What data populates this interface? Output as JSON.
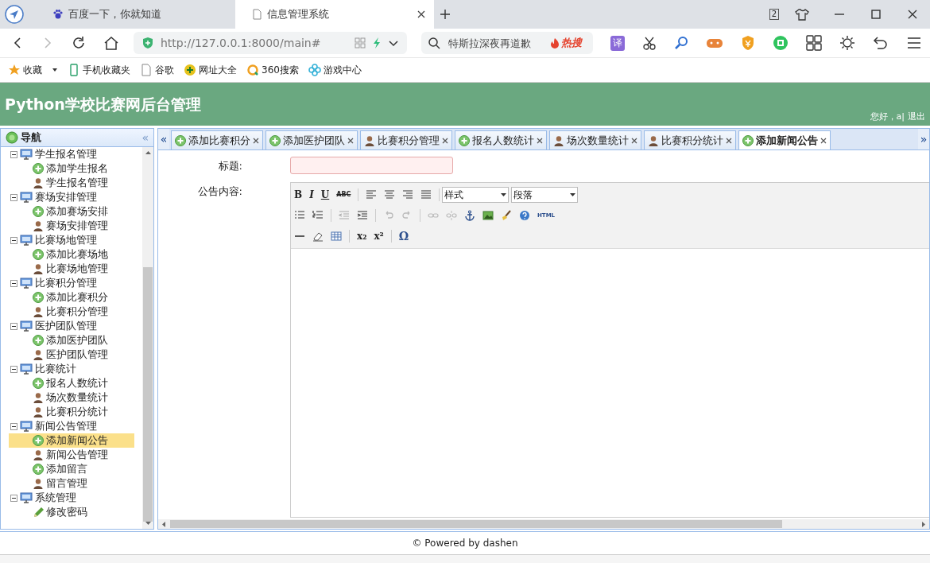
{
  "browser": {
    "tabs": [
      {
        "title": "百度一下，你就知道",
        "selected": false
      },
      {
        "title": "信息管理系统",
        "selected": true
      }
    ],
    "window_badge": "2",
    "url": "http://127.0.0.1:8000/main#",
    "search": {
      "placeholder": "特斯拉深夜再道歉",
      "hot": "热搜"
    },
    "translate": "译",
    "bookmarks": [
      "收藏",
      "手机收藏夹",
      "谷歌",
      "网址大全",
      "360搜索",
      "游戏中心"
    ]
  },
  "header": {
    "title": "Python学校比赛网后台管理",
    "greeting": "您好，a|",
    "logout": "退出"
  },
  "nav": {
    "title": "导航",
    "collapse": "«",
    "groups": [
      {
        "label": "学生报名管理",
        "expanded": true,
        "children": [
          {
            "label": "添加学生报名",
            "kind": "add",
            "selected": false
          },
          {
            "label": "学生报名管理",
            "kind": "user",
            "selected": false
          }
        ]
      },
      {
        "label": "赛场安排管理",
        "expanded": true,
        "children": [
          {
            "label": "添加赛场安排",
            "kind": "add",
            "selected": false
          },
          {
            "label": "赛场安排管理",
            "kind": "user",
            "selected": false
          }
        ]
      },
      {
        "label": "比赛场地管理",
        "expanded": true,
        "children": [
          {
            "label": "添加比赛场地",
            "kind": "add",
            "selected": false
          },
          {
            "label": "比赛场地管理",
            "kind": "user",
            "selected": false
          }
        ]
      },
      {
        "label": "比赛积分管理",
        "expanded": true,
        "children": [
          {
            "label": "添加比赛积分",
            "kind": "add",
            "selected": false
          },
          {
            "label": "比赛积分管理",
            "kind": "user",
            "selected": false
          }
        ]
      },
      {
        "label": "医护团队管理",
        "expanded": true,
        "children": [
          {
            "label": "添加医护团队",
            "kind": "add",
            "selected": false
          },
          {
            "label": "医护团队管理",
            "kind": "user",
            "selected": false
          }
        ]
      },
      {
        "label": "比赛统计",
        "expanded": true,
        "children": [
          {
            "label": "报名人数统计",
            "kind": "add",
            "selected": false
          },
          {
            "label": "场次数量统计",
            "kind": "user",
            "selected": false
          },
          {
            "label": "比赛积分统计",
            "kind": "user",
            "selected": false
          }
        ]
      },
      {
        "label": "新闻公告管理",
        "expanded": true,
        "children": [
          {
            "label": "添加新闻公告",
            "kind": "add",
            "selected": true
          },
          {
            "label": "新闻公告管理",
            "kind": "user",
            "selected": false
          },
          {
            "label": "添加留言",
            "kind": "add",
            "selected": false
          },
          {
            "label": "留言管理",
            "kind": "user",
            "selected": false
          }
        ]
      },
      {
        "label": "系统管理",
        "expanded": true,
        "children": [
          {
            "label": "修改密码",
            "kind": "pencil",
            "selected": false
          }
        ]
      }
    ]
  },
  "content_tabs": {
    "prev": "«",
    "next": "»",
    "tabs": [
      {
        "label": "添加比赛积分",
        "kind": "add",
        "selected": false
      },
      {
        "label": "添加医护团队",
        "kind": "add",
        "selected": false
      },
      {
        "label": "比赛积分管理",
        "kind": "user",
        "selected": false
      },
      {
        "label": "报名人数统计",
        "kind": "add",
        "selected": false
      },
      {
        "label": "场次数量统计",
        "kind": "user",
        "selected": false
      },
      {
        "label": "比赛积分统计",
        "kind": "user",
        "selected": false
      },
      {
        "label": "添加新闻公告",
        "kind": "add",
        "selected": true
      }
    ]
  },
  "form": {
    "title_label": "标题:",
    "content_label": "公告内容:",
    "style_select": "样式",
    "paragraph_select": "段落",
    "toolbar": [
      [
        {
          "kind": "bold",
          "text": "B"
        },
        {
          "kind": "italic",
          "text": "I"
        },
        {
          "kind": "underline",
          "text": "U"
        },
        {
          "kind": "strike",
          "text": "ABC"
        },
        {
          "kind": "sep"
        },
        {
          "kind": "align-left"
        },
        {
          "kind": "align-center"
        },
        {
          "kind": "align-right"
        },
        {
          "kind": "justify"
        },
        {
          "kind": "sep"
        },
        {
          "kind": "style-select"
        },
        {
          "kind": "paragraph-select"
        }
      ],
      [
        {
          "kind": "bullets"
        },
        {
          "kind": "numbers"
        },
        {
          "kind": "sep"
        },
        {
          "kind": "outdent"
        },
        {
          "kind": "indent"
        },
        {
          "kind": "sep"
        },
        {
          "kind": "undo"
        },
        {
          "kind": "redo"
        },
        {
          "kind": "sep"
        },
        {
          "kind": "link"
        },
        {
          "kind": "unlink"
        },
        {
          "kind": "anchor"
        },
        {
          "kind": "image"
        },
        {
          "kind": "brush"
        },
        {
          "kind": "help"
        },
        {
          "kind": "html",
          "text": "HTML"
        }
      ],
      [
        {
          "kind": "rule"
        },
        {
          "kind": "eraser"
        },
        {
          "kind": "table"
        },
        {
          "kind": "sep"
        },
        {
          "kind": "sub",
          "text": "x₂"
        },
        {
          "kind": "sup",
          "text": "x²"
        },
        {
          "kind": "sep"
        },
        {
          "kind": "omega",
          "text": "Ω"
        }
      ]
    ]
  },
  "footer": "© Powered by dashen"
}
